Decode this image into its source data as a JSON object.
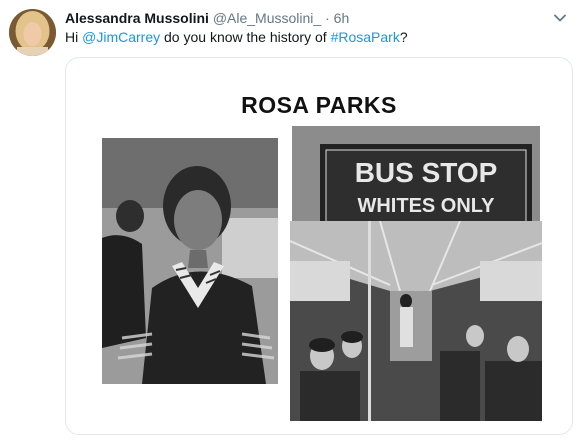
{
  "tweet": {
    "author_name": "Alessandra Mussolini",
    "handle": "@Ale_Mussolini_",
    "separator": "·",
    "time": "6h",
    "text_prefix": "Hi ",
    "mention": "@JimCarrey",
    "text_middle": " do you know the history of ",
    "hashtag": "#RosaPark",
    "text_suffix": "?"
  },
  "card": {
    "title": "ROSA PARKS",
    "sign_line1": "BUS STOP",
    "sign_line2": "WHITES ONLY"
  },
  "colors": {
    "link": "#1b95e0",
    "secondary_text": "#657786",
    "border": "#e1e8ed"
  },
  "icons": {
    "menu": "chevron-down-icon"
  }
}
